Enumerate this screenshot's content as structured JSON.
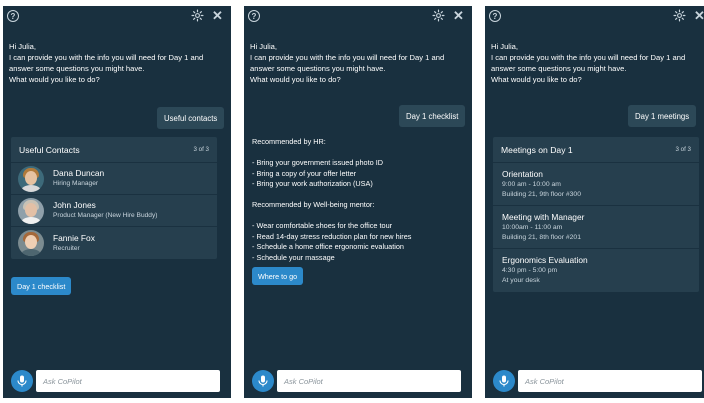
{
  "common": {
    "help_glyph": "?",
    "close_glyph": "✕",
    "greeting": "Hi Julia,\nI can provide you with the info you will need for Day 1 and\nanswer some questions you might have.\nWhat would you like to do?",
    "ask_placeholder": "Ask CoPilot",
    "colors": {
      "panel_bg": "#19303f",
      "card_bg": "#263f4e",
      "accent": "#2c89ca",
      "bubble_bg": "#2c4857"
    }
  },
  "panel1": {
    "user_message": "Useful contacts",
    "card_title": "Useful Contacts",
    "card_count": "3 of 3",
    "contacts": [
      {
        "name": "Dana Duncan",
        "role": "Hiring Manager"
      },
      {
        "name": "John Jones",
        "role": "Product Manager (New Hire Buddy)"
      },
      {
        "name": "Fannie Fox",
        "role": "Recruiter"
      }
    ],
    "action_button": "Day 1 checklist"
  },
  "panel2": {
    "user_message": "Day 1 checklist",
    "hr_heading": "Recommended by HR:",
    "hr_items": [
      "- Bring your government issued photo ID",
      "- Bring a copy of your offer letter",
      "- Bring your work authorization (USA)"
    ],
    "mentor_heading": "Recommended by Well-being mentor:",
    "mentor_items": [
      "- Wear comfortable shoes for the office tour",
      "- Read 14-day stress reduction plan for new hires",
      "- Schedule a home office ergonomic evaluation",
      "- Schedule your massage"
    ],
    "action_button": "Where to go"
  },
  "panel3": {
    "user_message": "Day 1 meetings",
    "card_title": "Meetings on Day 1",
    "card_count": "3 of 3",
    "meetings": [
      {
        "title": "Orientation",
        "time": "9:00 am - 10:00 am",
        "location": "Building 21, 9th floor #300"
      },
      {
        "title": "Meeting with Manager",
        "time": "10:00am - 11:00 am",
        "location": "Building 21, 8th floor #201"
      },
      {
        "title": "Ergonomics Evaluation",
        "time": "4:30 pm - 5:00 pm",
        "location": "At your desk"
      }
    ]
  }
}
